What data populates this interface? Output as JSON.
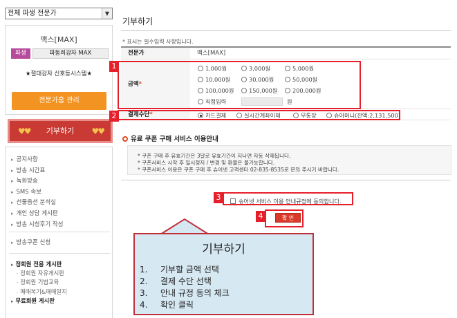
{
  "sidebar": {
    "expert_select": "전체 파생 전문가",
    "profile": {
      "name": "맥스[MAX]",
      "badge": "파생",
      "group": "파동희강자 MAX",
      "slogan": "★절대강자 신호등시스템★",
      "manage_button": "전문가홈 관리"
    },
    "donate_banner": "기부하기",
    "menu": [
      "공지사항",
      "방송 시간표",
      "녹화방송",
      "SMS 속보",
      "선물옵션 분석실",
      "개인 상담 게시판",
      "방송 시청후기 작성"
    ],
    "apply": "방송쿠폰 신청",
    "boards": [
      {
        "label": "정회원 전용 게시판",
        "kind": "h"
      },
      {
        "label": "정회원 자유게시판",
        "kind": "s"
      },
      {
        "label": "정회원 기법교육",
        "kind": "s"
      },
      {
        "label": "매매복기&매매일지",
        "kind": "s"
      },
      {
        "label": "무료회원 게시판",
        "kind": "h"
      }
    ]
  },
  "main": {
    "title": "기부하기",
    "required_note": "* 표시는 필수입력 사항입니다.",
    "expert_label": "전문가",
    "expert_value": "맥스[MAX]",
    "amount_label": "금액",
    "amount_options": [
      "1,000원",
      "3,000원",
      "5,000원",
      "10,000원",
      "30,000원",
      "50,000원",
      "100,000원",
      "150,000원",
      "200,000원"
    ],
    "direct_input_label": "직접입력",
    "won_unit": "원",
    "payment_label": "결제수단",
    "payment_options": [
      "카드결제",
      "실시간계좌이체",
      "무통장",
      "슈어머니(잔액:2,131,500)"
    ],
    "payment_selected_index": 0,
    "section_title": "유료 쿠폰 구매 서비스 이용안내",
    "notices": [
      "* 쿠폰 구매 후 유효기간은 3달로 유효기간이 지나면 자동 삭제됩니다.",
      "* 쿠폰서비스 시작 후 일시정지 / 변경 및 환불은 불가능합니다.",
      "* 쿠폰서비스 이용은 쿠폰 구매 후 슈어넷 고객센터 02-835-8535로 문의 주시기 바랍니다."
    ],
    "agree_label": "슈어넷 서비스 이용 안내규정에 동의합니다.",
    "confirm_button": "확 인"
  },
  "annotation": {
    "markers": [
      "1",
      "2",
      "3",
      "4"
    ],
    "callout_title": "기부하기",
    "steps": [
      {
        "num": "1.",
        "text": "기부할 금액 선택"
      },
      {
        "num": "2.",
        "text": "결제 수단 선택"
      },
      {
        "num": "3.",
        "text": "안내 규정 동의 체크"
      },
      {
        "num": "4.",
        "text": "확인 클릭"
      }
    ],
    "highlight_color": "#e6202a"
  }
}
